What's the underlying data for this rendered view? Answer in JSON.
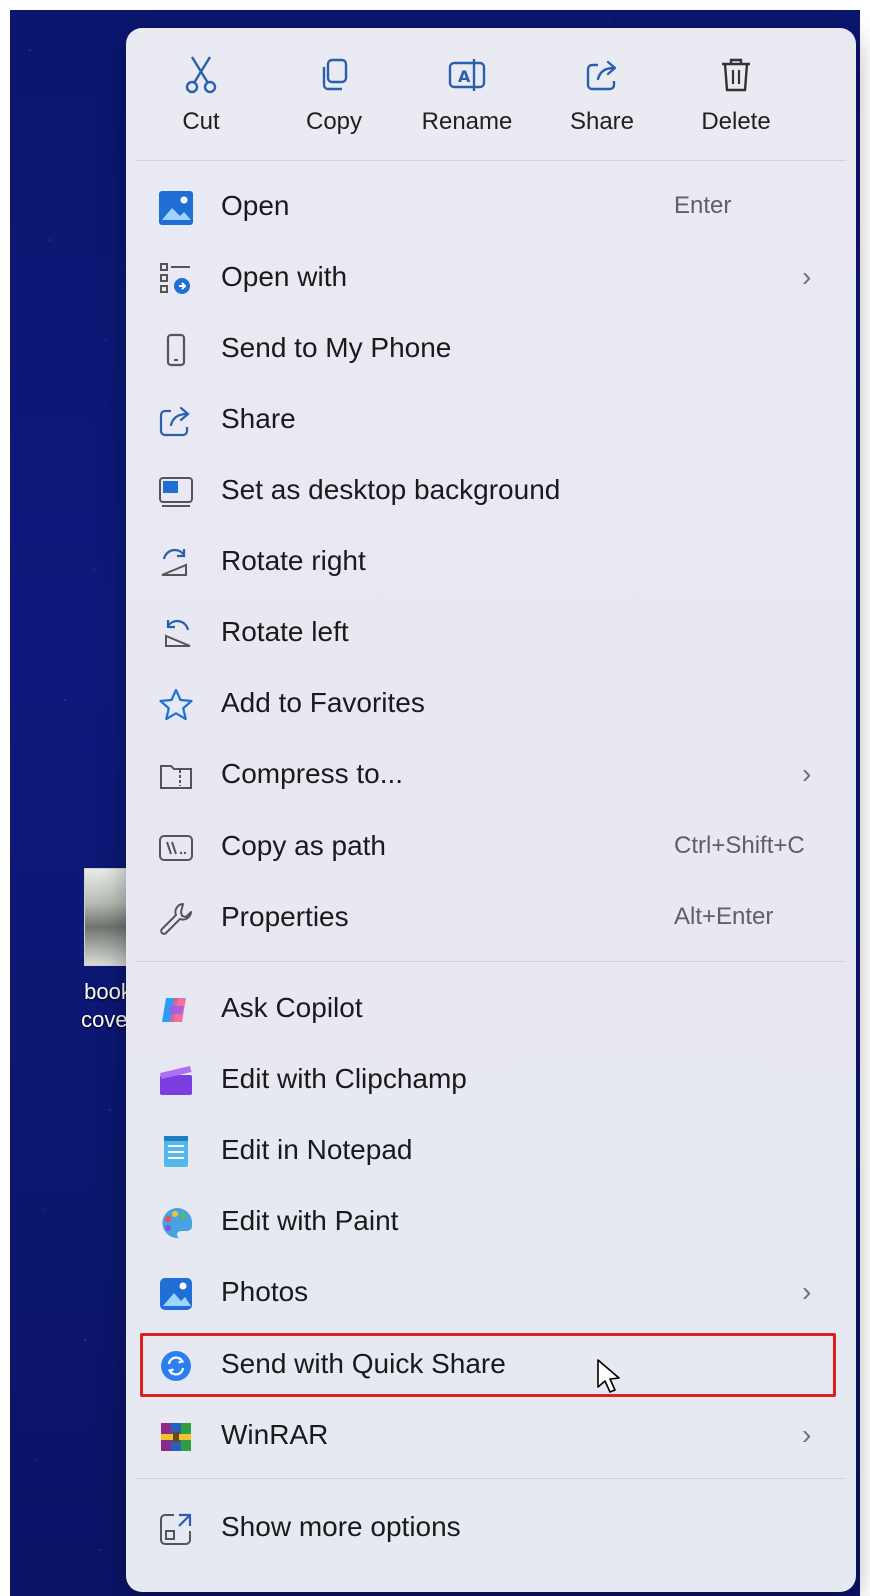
{
  "desktop": {
    "icon_label": "book cover"
  },
  "toolbar": [
    {
      "id": "cut",
      "label": "Cut",
      "icon": "scissors-icon"
    },
    {
      "id": "copy",
      "label": "Copy",
      "icon": "copy-icon"
    },
    {
      "id": "rename",
      "label": "Rename",
      "icon": "rename-icon"
    },
    {
      "id": "share",
      "label": "Share",
      "icon": "share-icon"
    },
    {
      "id": "delete",
      "label": "Delete",
      "icon": "trash-icon"
    }
  ],
  "items": [
    {
      "label": "Open",
      "accel": "Enter",
      "icon": "image-icon"
    },
    {
      "label": "Open with",
      "submenu": "›",
      "icon": "open-with-icon"
    },
    {
      "label": "Send to My Phone",
      "icon": "phone-icon"
    },
    {
      "label": "Share",
      "icon": "share-icon"
    },
    {
      "label": "Set as desktop background",
      "icon": "desktop-background-icon"
    },
    {
      "label": "Rotate right",
      "icon": "rotate-right-icon"
    },
    {
      "label": "Rotate left",
      "icon": "rotate-left-icon"
    },
    {
      "label": "Add to Favorites",
      "icon": "star-icon"
    },
    {
      "label": "Compress to...",
      "submenu": "›",
      "icon": "zip-folder-icon"
    },
    {
      "label": "Copy as path",
      "accel": "Ctrl+Shift+C",
      "icon": "path-icon"
    },
    {
      "label": "Properties",
      "accel": "Alt+Enter",
      "icon": "wrench-icon"
    },
    {
      "label": "Ask Copilot",
      "icon": "copilot-icon"
    },
    {
      "label": "Edit with Clipchamp",
      "icon": "clipchamp-icon"
    },
    {
      "label": "Edit in Notepad",
      "icon": "notepad-icon"
    },
    {
      "label": "Edit with Paint",
      "icon": "paint-icon"
    },
    {
      "label": "Photos",
      "submenu": "›",
      "icon": "photos-icon"
    },
    {
      "label": "Send with Quick Share",
      "icon": "quick-share-icon",
      "highlighted": true
    },
    {
      "label": "WinRAR",
      "submenu": "›",
      "icon": "winrar-icon"
    },
    {
      "label": "Show more options",
      "icon": "show-more-icon"
    }
  ],
  "colors": {
    "accent": "#1f6fd6",
    "highlight_border": "#e02020",
    "menu_bg": "#e8e9f3"
  }
}
